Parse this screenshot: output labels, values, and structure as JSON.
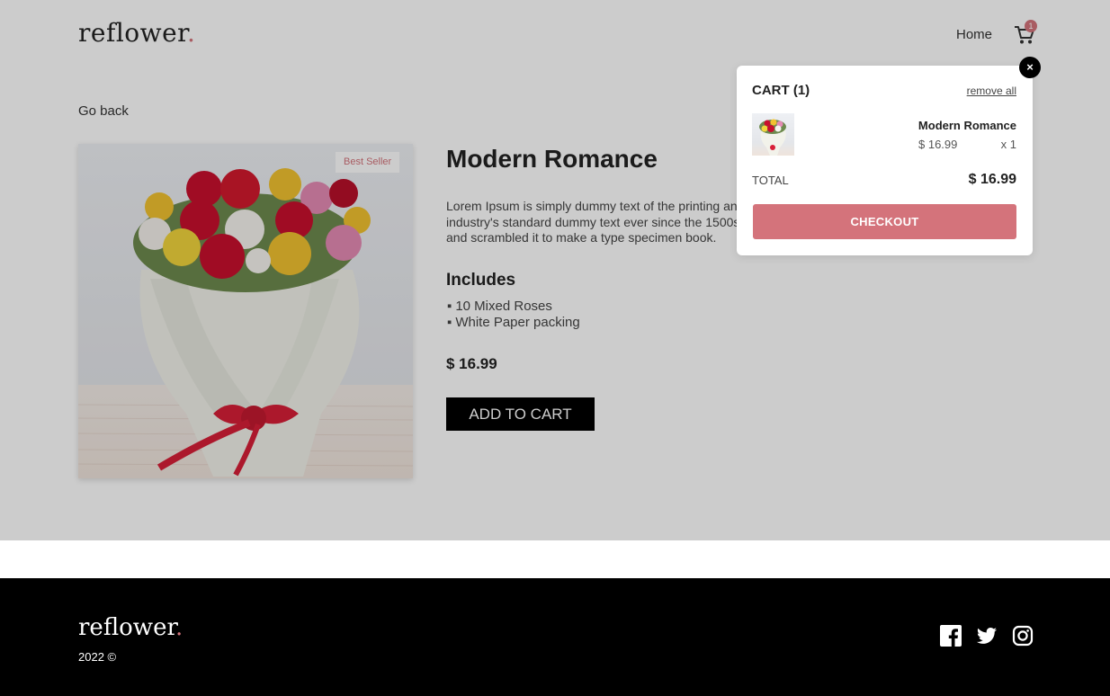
{
  "header": {
    "logo_text": "reflower",
    "logo_dot": ".",
    "nav_home": "Home",
    "cart_count": "1"
  },
  "main": {
    "go_back": "Go back",
    "badge": "Best Seller",
    "product_name": "Modern Romance",
    "description": "Lorem Ipsum is simply dummy text of the printing and typesetting industry. Lorem Ipsum has been the industry's standard dummy text ever since the 1500s, when an unknown printer took a galley of type and scrambled it to make a type specimen book.",
    "includes_heading": "Includes",
    "includes": [
      "10 Mixed Roses",
      "White Paper packing"
    ],
    "price": "$ 16.99",
    "add_to_cart": "ADD TO CART"
  },
  "cart_popup": {
    "close": "×",
    "title": "CART (1)",
    "remove_all": "remove all",
    "items": [
      {
        "name": "Modern Romance",
        "price": "$ 16.99",
        "qty": "x 1"
      }
    ],
    "total_label": "TOTAL",
    "total_value": "$ 16.99",
    "checkout": "CHECKOUT"
  },
  "footer": {
    "logo_text": "reflower",
    "logo_dot": ".",
    "copyright": "2022 ©",
    "social_icons": [
      "facebook-icon",
      "twitter-icon",
      "instagram-icon"
    ]
  },
  "colors": {
    "accent": "#d4737b",
    "footer_bg": "#000000",
    "button_bg": "#000000",
    "overlay": "rgba(0,0,0,0.2)"
  }
}
